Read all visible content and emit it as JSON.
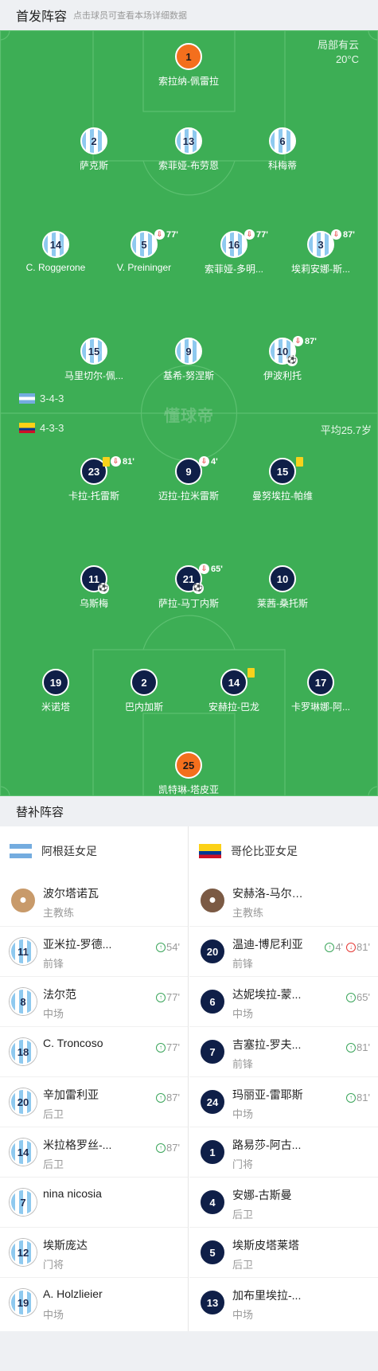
{
  "header": {
    "title": "首发阵容",
    "subtitle": "点击球员可查看本场详细数据"
  },
  "weather": {
    "desc": "局部有云",
    "temp": "20°C"
  },
  "watermark": "懂球帝",
  "home": {
    "formation": "3-4-3"
  },
  "away": {
    "formation": "4-3-3",
    "avg_age": "平均25.7岁"
  },
  "lineup_home": [
    {
      "num": "1",
      "name": "索拉纳-佩雷拉"
    },
    {
      "num": "2",
      "name": "萨克斯"
    },
    {
      "num": "13",
      "name": "索菲娅-布劳恩"
    },
    {
      "num": "6",
      "name": "科梅蒂"
    },
    {
      "num": "14",
      "name": "C. Roggerone"
    },
    {
      "num": "5",
      "name": "V. Preininger",
      "sub": "77'"
    },
    {
      "num": "16",
      "name": "索菲娅-多明...",
      "sub": "77'"
    },
    {
      "num": "3",
      "name": "埃莉安娜-斯...",
      "sub": "87'"
    },
    {
      "num": "15",
      "name": "马里切尔-佩..."
    },
    {
      "num": "9",
      "name": "基希-努涅斯"
    },
    {
      "num": "10",
      "name": "伊波利托",
      "sub": "87'"
    }
  ],
  "lineup_away": [
    {
      "num": "23",
      "name": "卡拉-托雷斯",
      "sub": "81'"
    },
    {
      "num": "9",
      "name": "迈拉-拉米雷斯",
      "sub": "4'"
    },
    {
      "num": "15",
      "name": "曼努埃拉-帕维"
    },
    {
      "num": "11",
      "name": "乌斯梅"
    },
    {
      "num": "21",
      "name": "萨拉-马丁内斯",
      "sub": "65'"
    },
    {
      "num": "10",
      "name": "莱茜-桑托斯"
    },
    {
      "num": "19",
      "name": "米诺塔"
    },
    {
      "num": "2",
      "name": "巴内加斯"
    },
    {
      "num": "14",
      "name": "安赫拉-巴龙"
    },
    {
      "num": "17",
      "name": "卡罗琳娜-阿..."
    },
    {
      "num": "25",
      "name": "凯特琳-塔皮亚"
    }
  ],
  "subs": {
    "title": "替补阵容",
    "home_team": "阿根廷女足",
    "away_team": "哥伦比亚女足",
    "home": [
      {
        "num": "",
        "name": "波尔塔诺瓦",
        "pos": "主教练",
        "in": "",
        "out": ""
      },
      {
        "num": "11",
        "name": "亚米拉-罗德...",
        "pos": "前锋",
        "in": "54'",
        "out": ""
      },
      {
        "num": "8",
        "name": "法尔范",
        "pos": "中场",
        "in": "77'",
        "out": ""
      },
      {
        "num": "18",
        "name": "C. Troncoso",
        "pos": "",
        "in": "77'",
        "out": ""
      },
      {
        "num": "20",
        "name": "辛加雷利亚",
        "pos": "后卫",
        "in": "87'",
        "out": ""
      },
      {
        "num": "14",
        "name": "米拉格罗丝-...",
        "pos": "后卫",
        "in": "87'",
        "out": ""
      },
      {
        "num": "7",
        "name": "nina nicosia",
        "pos": "",
        "in": "",
        "out": ""
      },
      {
        "num": "12",
        "name": "埃斯庞达",
        "pos": "门将",
        "in": "",
        "out": ""
      },
      {
        "num": "19",
        "name": "A. Holzlieier",
        "pos": "中场",
        "in": "",
        "out": ""
      }
    ],
    "away": [
      {
        "num": "",
        "name": "安赫洛-马尔西利亚",
        "pos": "主教练",
        "in": "",
        "out": ""
      },
      {
        "num": "20",
        "name": "温迪-博尼利亚",
        "pos": "前锋",
        "in": "4'",
        "out": "81'"
      },
      {
        "num": "6",
        "name": "达妮埃拉-蒙...",
        "pos": "中场",
        "in": "65'",
        "out": ""
      },
      {
        "num": "7",
        "name": "吉塞拉-罗夫...",
        "pos": "前锋",
        "in": "81'",
        "out": ""
      },
      {
        "num": "24",
        "name": "玛丽亚-雷耶斯",
        "pos": "中场",
        "in": "81'",
        "out": ""
      },
      {
        "num": "1",
        "name": "路易莎-阿古...",
        "pos": "门将",
        "in": "",
        "out": ""
      },
      {
        "num": "4",
        "name": "安娜-古斯曼",
        "pos": "后卫",
        "in": "",
        "out": ""
      },
      {
        "num": "5",
        "name": "埃斯皮塔莱塔",
        "pos": "后卫",
        "in": "",
        "out": ""
      },
      {
        "num": "13",
        "name": "加布里埃拉-...",
        "pos": "中场",
        "in": "",
        "out": ""
      }
    ]
  },
  "icons": {
    "sub_out": "substitution-out-icon",
    "sub_in": "substitution-in-icon",
    "yellow": "yellow-card-icon",
    "goal": "goal-ball-icon"
  },
  "colors": {
    "pitch": "#3dae55",
    "home_shirt": "#8ec9ef",
    "away_shirt": "#0f1f48",
    "keeper": "#f36f1d"
  }
}
